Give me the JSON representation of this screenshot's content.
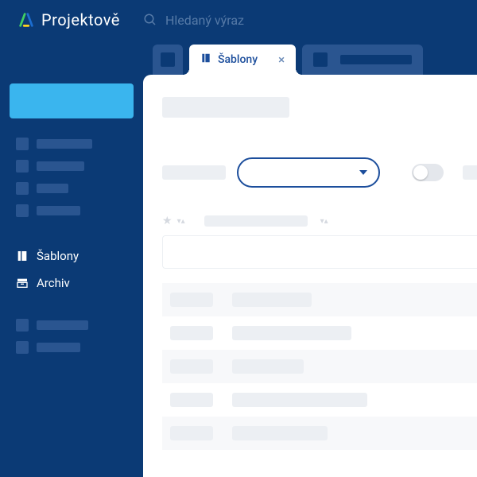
{
  "app": {
    "name": "Projektově"
  },
  "search": {
    "placeholder": "Hledaný výraz"
  },
  "sidebar": {
    "templates_label": "Šablony",
    "archive_label": "Archiv"
  },
  "tabs": {
    "active_label": "Šablony"
  }
}
